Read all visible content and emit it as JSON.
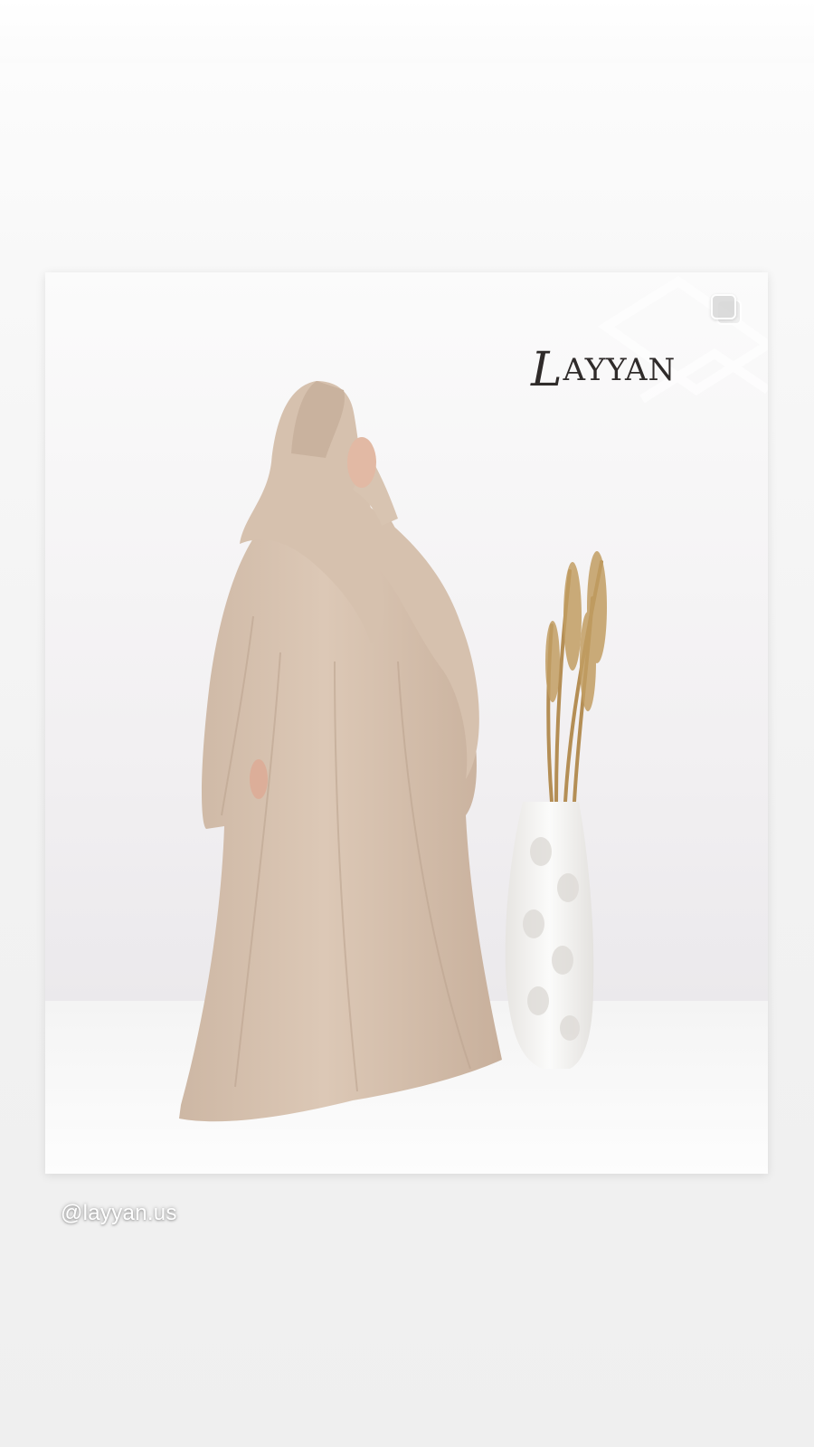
{
  "story": {
    "brand_logo": "LAYYAN",
    "media_icon": "multiple-posts-icon",
    "username": "@layyan.us"
  },
  "colors": {
    "garment": "#d9c5b3",
    "background": "#f6f5f6",
    "floor": "#fbfbfb",
    "logo": "#2f2b2a",
    "vase": "#f4f3f1",
    "pampas": "#b79257"
  }
}
